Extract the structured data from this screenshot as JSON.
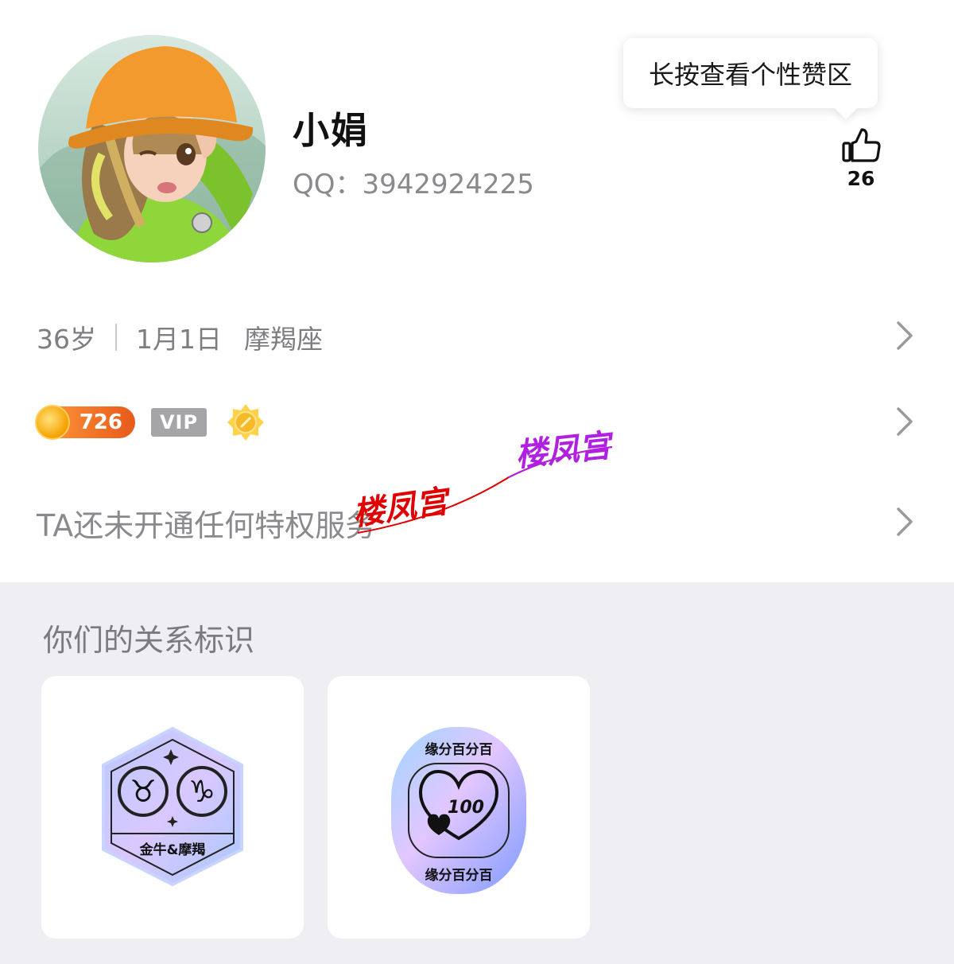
{
  "profile": {
    "name": "小娟",
    "qq": "QQ：3942924225"
  },
  "tooltip": {
    "text": "长按查看个性赞区"
  },
  "like": {
    "icon": "thumbs-up-icon",
    "count": "26"
  },
  "info": {
    "age": "36岁",
    "birthday": "1月1日",
    "zodiac": "摩羯座"
  },
  "badges": {
    "coin_level": "726",
    "vip_label": "VIP",
    "sun_icon": "sun-badge-icon"
  },
  "privilege": {
    "text": "TA还未开通任何特权服务"
  },
  "watermark": {
    "text_red": "楼凤宫",
    "text_purple": "楼凤宫"
  },
  "relationship": {
    "title": "你们的关系标识",
    "cards": [
      {
        "label": "金牛&摩羯",
        "symbols": [
          "♉",
          "♑"
        ]
      },
      {
        "top_text": "缘分百分百",
        "number": "100",
        "bottom_text": "缘分百分百"
      }
    ]
  },
  "colors": {
    "accent_orange": "#e65a1a",
    "gray_text": "#8a8a8e",
    "section_bg": "#efeff3"
  }
}
